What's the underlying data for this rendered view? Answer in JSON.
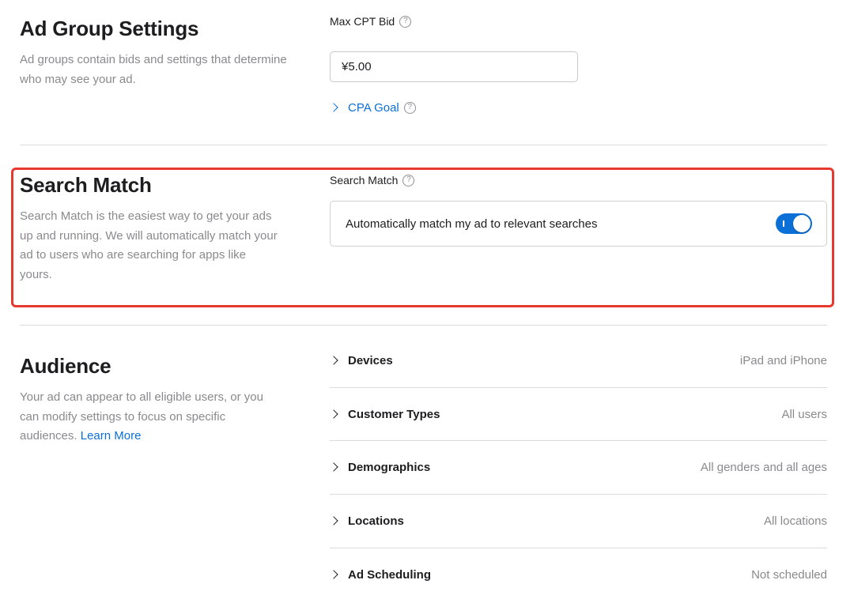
{
  "ad_group": {
    "title": "Ad Group Settings",
    "description": "Ad groups contain bids and settings that determine who may see your ad.",
    "max_cpt_label": "Max CPT Bid",
    "max_cpt_value": "¥5.00",
    "cpa_goal_label": "CPA Goal",
    "help_icon": "question-circle-icon"
  },
  "search_match": {
    "title": "Search Match",
    "description": "Search Match is the easiest way to get your ads up and running. We will automatically match your ad to users who are searching for apps like yours.",
    "field_label": "Search Match",
    "toggle_text": "Automatically match my ad to relevant searches",
    "toggle_on": true,
    "highlight_color": "#e8392f"
  },
  "audience": {
    "title": "Audience",
    "description": "Your ad can appear to all eligible users, or you can modify settings to focus on specific audiences.",
    "learn_more": "Learn More",
    "rows": [
      {
        "name": "Devices",
        "value": "iPad and iPhone"
      },
      {
        "name": "Customer Types",
        "value": "All users"
      },
      {
        "name": "Demographics",
        "value": "All genders and all ages"
      },
      {
        "name": "Locations",
        "value": "All locations"
      },
      {
        "name": "Ad Scheduling",
        "value": "Not scheduled"
      }
    ]
  },
  "colors": {
    "accent": "#0a6fd6",
    "secondary_text": "#8a8a8e",
    "divider": "#dcdcde"
  }
}
